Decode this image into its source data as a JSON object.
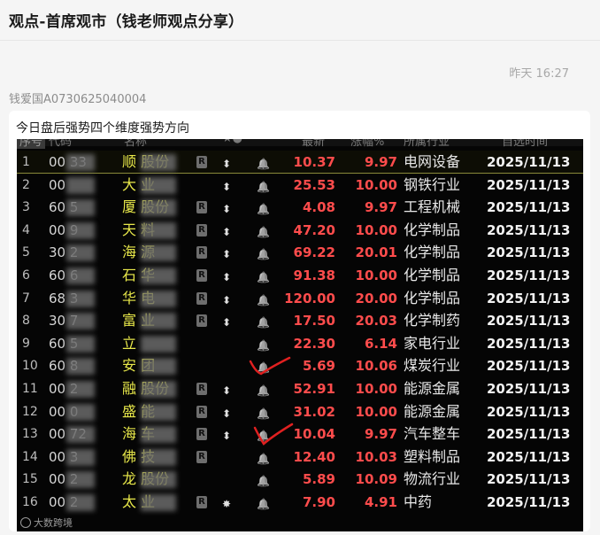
{
  "window": {
    "title": "观点-首席观市（钱老师观点分享）"
  },
  "message": {
    "timestamp": "昨天 16:27",
    "sender": "钱爱国A0730625040004",
    "caption": "今日盘后强势四个维度强势方向"
  },
  "table": {
    "headers": {
      "idx": "序号",
      "code": "代码",
      "name": "名称",
      "flags": "★●",
      "price": "最新",
      "pct": "涨幅%",
      "industry": "所属行业",
      "date": "自选时间"
    },
    "rows": [
      {
        "idx": "1",
        "code": "00  33",
        "name": "顺  股份",
        "r": true,
        "arrow": "⬍",
        "price": "10.37",
        "pct": "9.97",
        "industry": "电网设备",
        "date": "2025/11/13"
      },
      {
        "idx": "2",
        "code": "00  ",
        "name": "大  业",
        "r": false,
        "arrow": "⬍",
        "price": "25.53",
        "pct": "10.00",
        "industry": "钢铁行业",
        "date": "2025/11/13"
      },
      {
        "idx": "3",
        "code": "60  5",
        "name": "厦  股份",
        "r": true,
        "arrow": "⬍",
        "price": "4.08",
        "pct": "9.97",
        "industry": "工程机械",
        "date": "2025/11/13"
      },
      {
        "idx": "4",
        "code": "00  9",
        "name": "天  料",
        "r": true,
        "arrow": "⬍",
        "price": "47.20",
        "pct": "10.00",
        "industry": "化学制品",
        "date": "2025/11/13"
      },
      {
        "idx": "5",
        "code": "30  2",
        "name": "海  源",
        "r": true,
        "arrow": "⬍",
        "price": "69.22",
        "pct": "20.01",
        "industry": "化学制品",
        "date": "2025/11/13"
      },
      {
        "idx": "6",
        "code": "60  6",
        "name": "石  华",
        "r": true,
        "arrow": "⬍",
        "price": "91.38",
        "pct": "10.00",
        "industry": "化学制品",
        "date": "2025/11/13"
      },
      {
        "idx": "7",
        "code": "68  3",
        "name": "华  电",
        "r": true,
        "arrow": "⬍",
        "price": "120.00",
        "pct": "20.00",
        "industry": "化学制品",
        "date": "2025/11/13"
      },
      {
        "idx": "8",
        "code": "30  7",
        "name": "富  业",
        "r": true,
        "arrow": "⬍",
        "price": "17.50",
        "pct": "20.03",
        "industry": "化学制药",
        "date": "2025/11/13"
      },
      {
        "idx": "9",
        "code": "60  5",
        "name": "立  ",
        "r": false,
        "arrow": "",
        "price": "22.30",
        "pct": "6.14",
        "industry": "家电行业",
        "date": "2025/11/13"
      },
      {
        "idx": "10",
        "code": "60  8",
        "name": "安  团",
        "r": false,
        "arrow": "",
        "price": "5.69",
        "pct": "10.06",
        "industry": "煤炭行业",
        "date": "2025/11/13"
      },
      {
        "idx": "11",
        "code": "00  2",
        "name": "融  股份",
        "r": true,
        "arrow": "⬍",
        "price": "52.91",
        "pct": "10.00",
        "industry": "能源金属",
        "date": "2025/11/13"
      },
      {
        "idx": "12",
        "code": "00  0",
        "name": "盛  能",
        "r": true,
        "arrow": "⬍",
        "price": "31.02",
        "pct": "10.00",
        "industry": "能源金属",
        "date": "2025/11/13"
      },
      {
        "idx": "13",
        "code": "00  72",
        "name": "海  车",
        "r": true,
        "arrow": "⬍",
        "price": "10.04",
        "pct": "9.97",
        "industry": "汽车整车",
        "date": "2025/11/13"
      },
      {
        "idx": "14",
        "code": "00  3",
        "name": "佛  技",
        "r": true,
        "arrow": "",
        "price": "12.40",
        "pct": "10.03",
        "industry": "塑料制品",
        "date": "2025/11/13"
      },
      {
        "idx": "15",
        "code": "00  2",
        "name": "龙  股份",
        "r": false,
        "arrow": "",
        "price": "5.89",
        "pct": "10.09",
        "industry": "物流行业",
        "date": "2025/11/13"
      },
      {
        "idx": "16",
        "code": "00  2",
        "name": "太  业",
        "r": true,
        "arrow": "✸",
        "price": "7.90",
        "pct": "4.91",
        "industry": "中药",
        "date": "2025/11/13"
      }
    ]
  },
  "watermark": {
    "text": "大数跨境"
  },
  "colors": {
    "price_up": "#ff4c4c",
    "name_yellow": "#e8e84a",
    "check_red": "#e02020"
  }
}
